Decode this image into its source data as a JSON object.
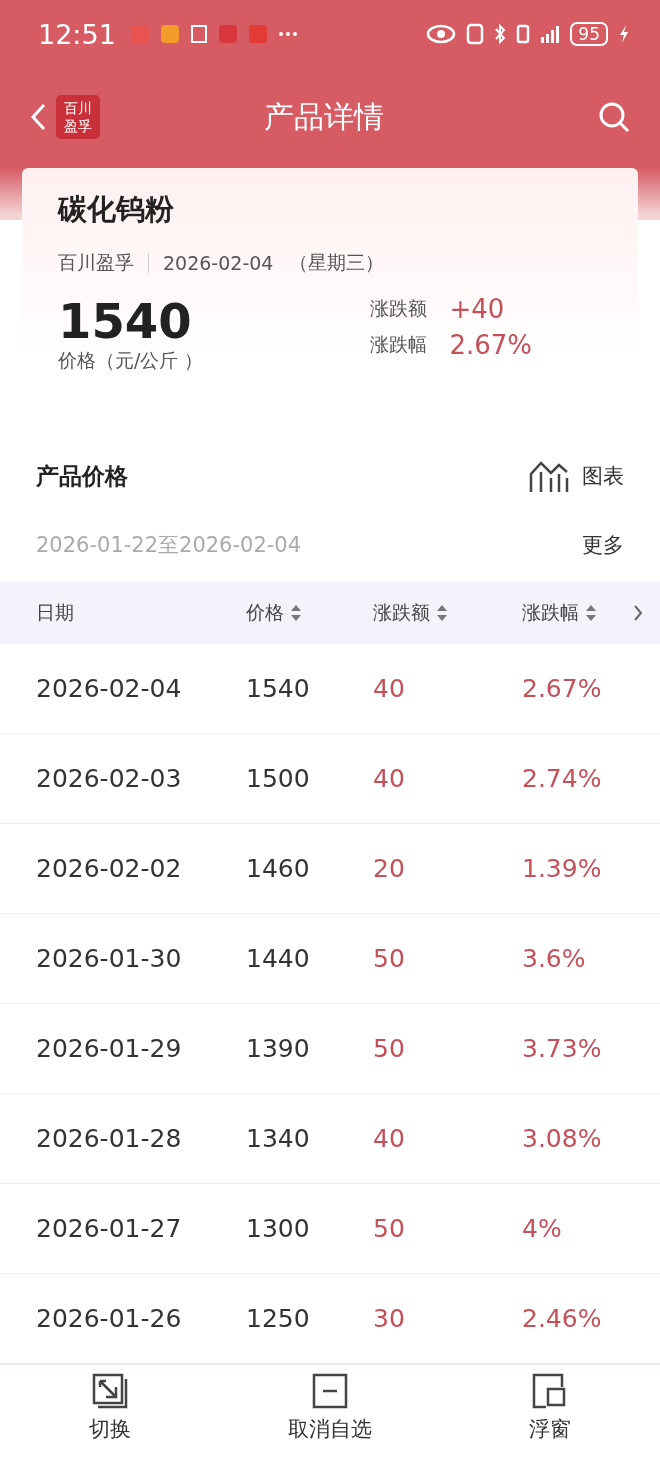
{
  "status_bar": {
    "time": "12:51",
    "battery": "95"
  },
  "header": {
    "title": "产品详情",
    "logo_lines": [
      "百川",
      "盈孚"
    ]
  },
  "product": {
    "name": "碳化钨粉",
    "source": "百川盈孚",
    "date": "2026-02-04",
    "weekday": "（星期三）",
    "price": "1540",
    "price_label": "价格（元/公斤 ）",
    "changes": [
      {
        "label": "涨跌额",
        "value": "+40"
      },
      {
        "label": "涨跌幅",
        "value": "2.67%"
      }
    ]
  },
  "section": {
    "title": "产品价格",
    "chart_link": "图表",
    "range": "2026-01-22至2026-02-04",
    "more": "更多"
  },
  "table": {
    "columns": [
      {
        "label": "日期",
        "sortable": false
      },
      {
        "label": "价格",
        "sortable": true
      },
      {
        "label": "涨跌额",
        "sortable": true
      },
      {
        "label": "涨跌幅",
        "sortable": true
      }
    ],
    "rows": [
      [
        "2026-02-04",
        "1540",
        "40",
        "2.67%"
      ],
      [
        "2026-02-03",
        "1500",
        "40",
        "2.74%"
      ],
      [
        "2026-02-02",
        "1460",
        "20",
        "1.39%"
      ],
      [
        "2026-01-30",
        "1440",
        "50",
        "3.6%"
      ],
      [
        "2026-01-29",
        "1390",
        "50",
        "3.73%"
      ],
      [
        "2026-01-28",
        "1340",
        "40",
        "3.08%"
      ],
      [
        "2026-01-27",
        "1300",
        "50",
        "4%"
      ],
      [
        "2026-01-26",
        "1250",
        "30",
        "2.46%"
      ]
    ]
  },
  "bottom_bar": [
    {
      "kind": "switch",
      "label": "切换"
    },
    {
      "kind": "unfollow",
      "label": "取消自选"
    },
    {
      "kind": "float",
      "label": "浮窗"
    }
  ]
}
